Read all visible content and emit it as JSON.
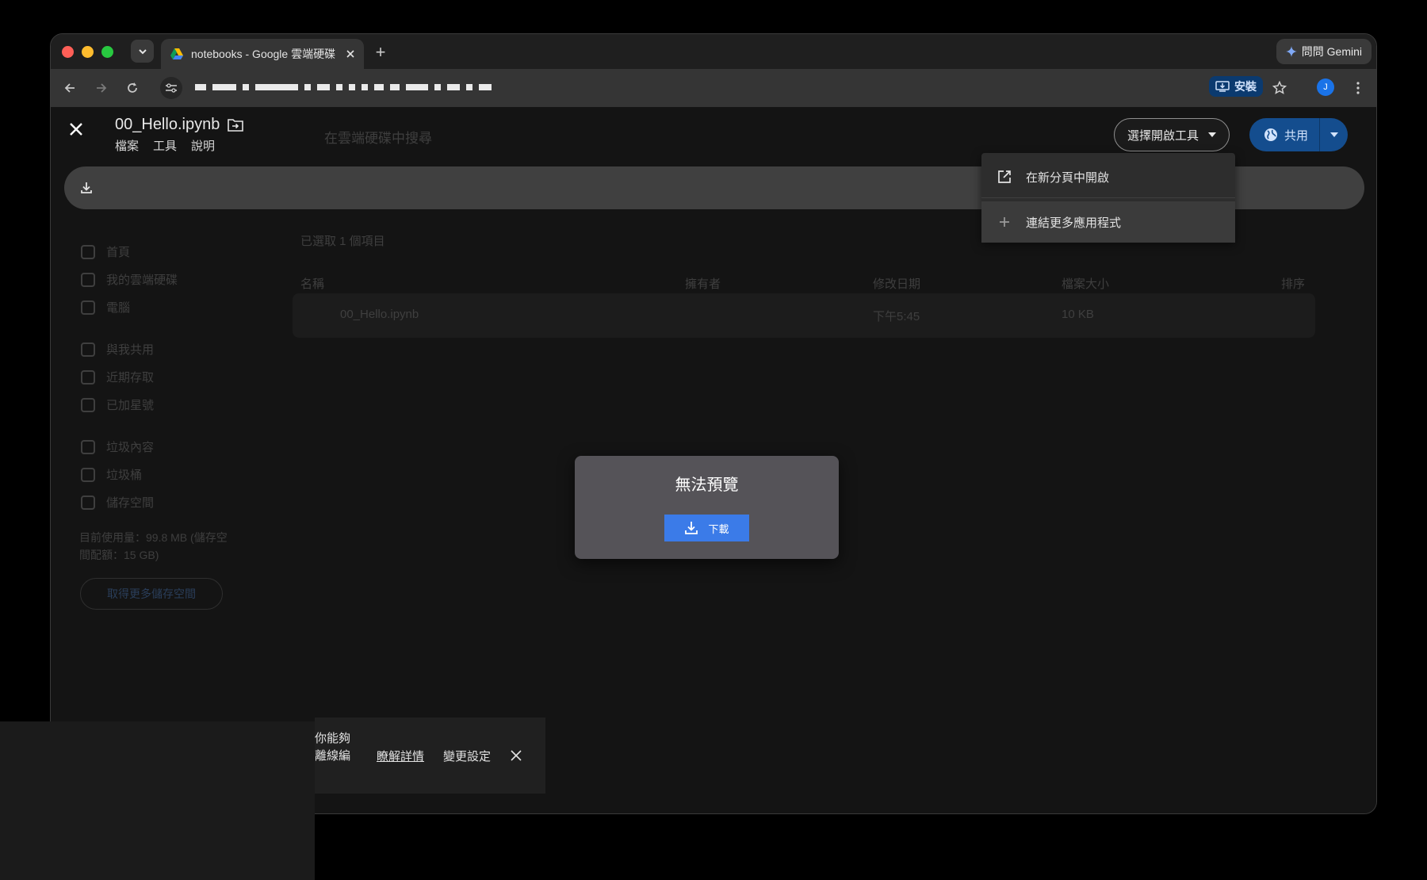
{
  "browser": {
    "tab_title": "notebooks - Google 雲端硬碟",
    "new_tab_symbol": "+",
    "gemini_label": "問問 Gemini",
    "install_label": "安裝",
    "profile_initial": "J"
  },
  "viewer": {
    "file_name": "00_Hello.ipynb",
    "menu": [
      "檔案",
      "工具",
      "說明"
    ],
    "open_with_label": "選擇開啟工具",
    "share_label": "共用"
  },
  "open_with_menu": {
    "items": [
      {
        "label": "在新分頁中開啟",
        "icon": "open-in-new-icon"
      },
      {
        "label": "連結更多應用程式",
        "icon": "plus-icon"
      }
    ]
  },
  "preview_dialog": {
    "title": "無法預覽",
    "download_label": "下載"
  },
  "background_drive": {
    "search_placeholder": "在雲端硬碟中搜尋",
    "sidebar": [
      "首頁",
      "我的雲端硬碟",
      "電腦",
      "與我共用",
      "近期存取",
      "已加星號",
      "垃圾內容",
      "垃圾桶",
      "儲存空間"
    ],
    "selection_text": "已選取 1 個項目",
    "columns": [
      "名稱",
      "擁有者",
      "修改日期",
      "檔案大小",
      "排序"
    ],
    "row": {
      "name": "00_Hello.ipynb",
      "modified": "下午5:45",
      "size": "10 KB"
    },
    "storage_text": "目前使用量：99.8 MB (儲存空間配額：15 GB)",
    "storage_button": "取得更多儲存空間"
  },
  "notice": {
    "text_line1": "你能夠",
    "text_line2": "離線編",
    "learn_more": "瞭解詳情",
    "change_settings": "變更設定"
  }
}
